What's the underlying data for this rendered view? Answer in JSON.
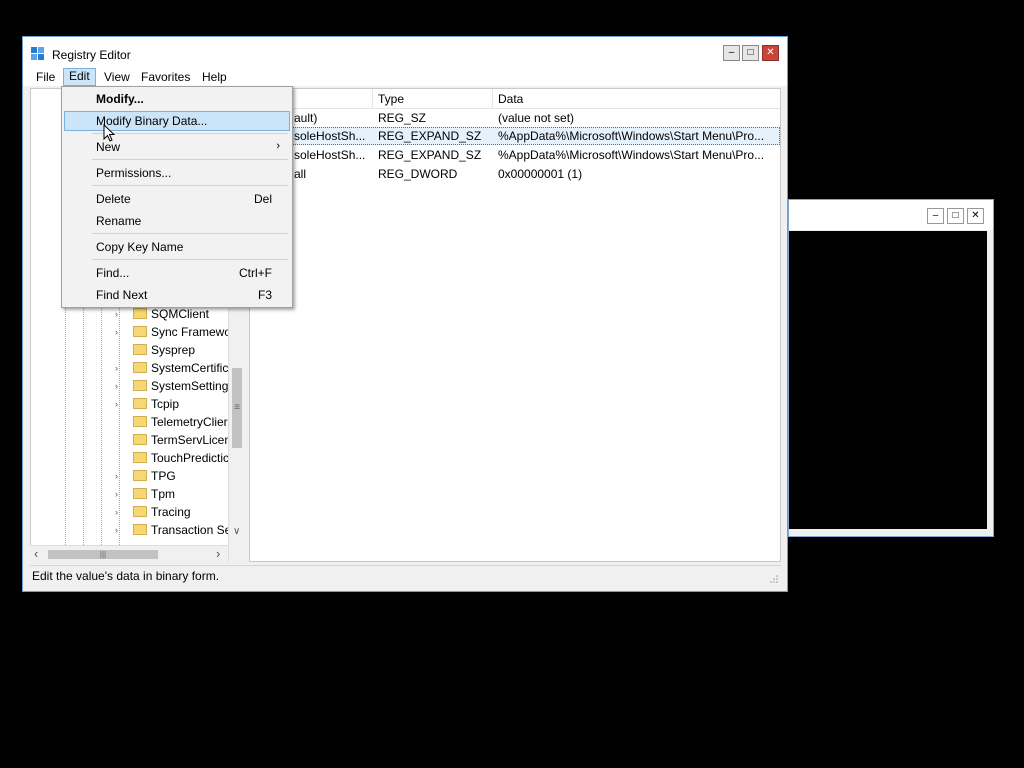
{
  "window": {
    "title": "Registry Editor",
    "minimize": "–",
    "maximize": "□",
    "close": "✕"
  },
  "menubar": [
    "File",
    "Edit",
    "View",
    "Favorites",
    "Help"
  ],
  "edit_menu": {
    "modify": "Modify...",
    "modify_binary": "Modify Binary Data...",
    "new": "New",
    "new_arrow": "›",
    "permissions": "Permissions...",
    "delete": "Delete",
    "delete_shortcut": "Del",
    "rename": "Rename",
    "copy_key_name": "Copy Key Name",
    "find": "Find...",
    "find_shortcut": "Ctrl+F",
    "find_next": "Find Next",
    "find_next_shortcut": "F3"
  },
  "tree": {
    "items": [
      "SQMClient",
      "Sync Framewo",
      "Sysprep",
      "SystemCertific",
      "SystemSetting",
      "Tcpip",
      "TelemetryClier",
      "TermServLicen",
      "TouchPredictic",
      "TPG",
      "Tpm",
      "Tracing",
      "Transaction Se"
    ],
    "expanders": [
      "›",
      "›",
      "",
      "›",
      "›",
      "›",
      "",
      "",
      "",
      "›",
      "›",
      "›",
      "›"
    ]
  },
  "list": {
    "headers": [
      "Type",
      "Data"
    ],
    "rows": [
      {
        "name": "ault)",
        "type": "REG_SZ",
        "data": "(value not set)"
      },
      {
        "name": "soleHostSh...",
        "type": "REG_EXPAND_SZ",
        "data": "%AppData%\\Microsoft\\Windows\\Start Menu\\Pro..."
      },
      {
        "name": "soleHostSh...",
        "type": "REG_EXPAND_SZ",
        "data": "%AppData%\\Microsoft\\Windows\\Start Menu\\Pro..."
      },
      {
        "name": "all",
        "type": "REG_DWORD",
        "data": "0x00000001 (1)"
      }
    ]
  },
  "status": "Edit the value's data in binary form.",
  "scroll": {
    "left": "‹",
    "right": "›",
    "down": "∨",
    "thumb_grip": "≡",
    "hthumb_grip": "|||"
  },
  "second_window": {
    "minimize": "–",
    "maximize": "□",
    "close": "✕"
  }
}
